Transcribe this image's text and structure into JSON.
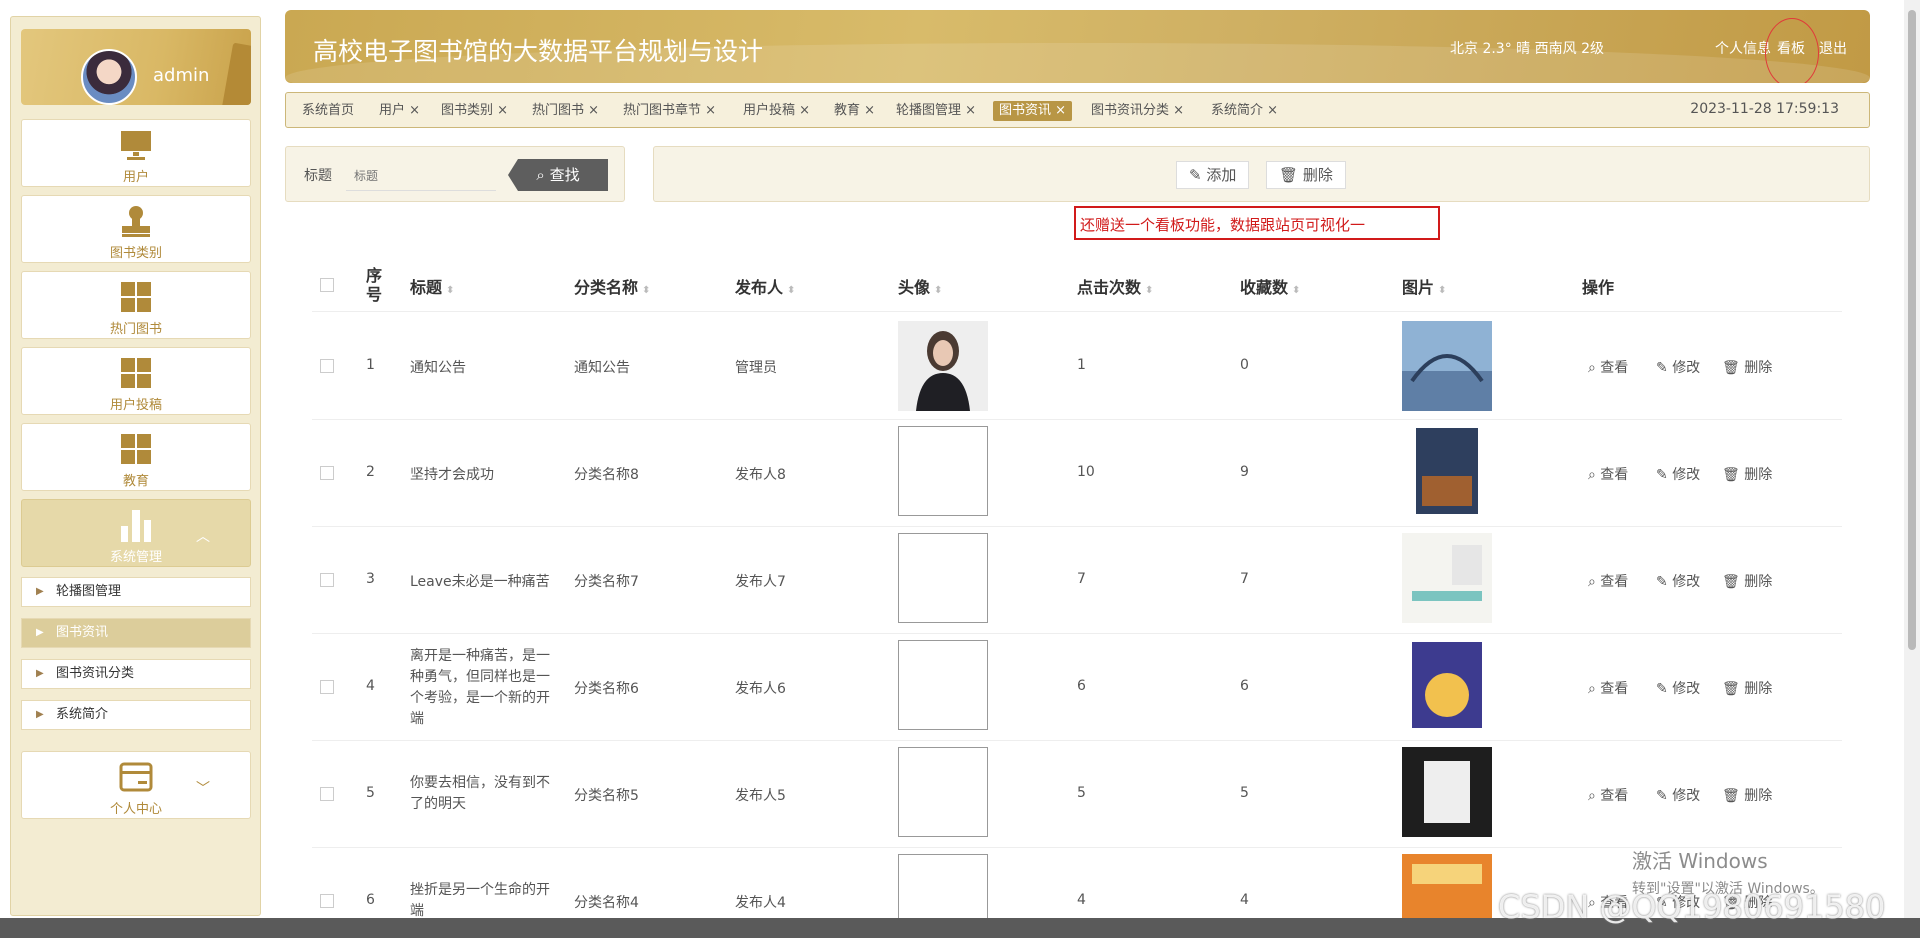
{
  "sidebar": {
    "username": "admin",
    "nav": [
      {
        "label": "用户",
        "icon": "monitor-icon"
      },
      {
        "label": "图书类别",
        "icon": "stamp-icon"
      },
      {
        "label": "热门图书",
        "icon": "grid-icon"
      },
      {
        "label": "用户投稿",
        "icon": "grid-icon"
      },
      {
        "label": "教育",
        "icon": "grid-icon"
      },
      {
        "label": "系统管理",
        "icon": "bar-chart-icon"
      }
    ],
    "sub_items": [
      {
        "label": "轮播图管理"
      },
      {
        "label": "图书资讯"
      },
      {
        "label": "图书资讯分类"
      },
      {
        "label": "系统简介"
      }
    ],
    "personal": {
      "label": "个人中心",
      "icon": "card-icon"
    }
  },
  "header": {
    "title": "高校电子图书馆的大数据平台规划与设计",
    "weather": "北京  2.3°  晴  西南风  2级",
    "links": [
      "个人信息",
      "看板",
      "退出"
    ]
  },
  "tabs": [
    {
      "label": "系统首页"
    },
    {
      "label": "用户 ×"
    },
    {
      "label": "图书类别 ×"
    },
    {
      "label": "热门图书 ×"
    },
    {
      "label": "热门图书章节 ×"
    },
    {
      "label": "用户投稿 ×"
    },
    {
      "label": "教育 ×"
    },
    {
      "label": "轮播图管理 ×"
    },
    {
      "label": "图书资讯 ×"
    },
    {
      "label": "图书资讯分类 ×"
    },
    {
      "label": "系统简介 ×"
    }
  ],
  "datetime": "2023-11-28 17:59:13",
  "search": {
    "label": "标题",
    "placeholder": "标题",
    "button": "查找"
  },
  "actions": {
    "add": "添加",
    "delete": "删除"
  },
  "annotation": "还赠送一个看板功能，数据跟站页可视化一",
  "table": {
    "headers": [
      "序号",
      "标题",
      "分类名称",
      "发布人",
      "头像",
      "点击次数",
      "收藏数",
      "图片",
      "操作"
    ],
    "rows": [
      {
        "no": "1",
        "title": "通知公告",
        "category": "通知公告",
        "publisher": "管理员",
        "clicks": "1",
        "favs": "0"
      },
      {
        "no": "2",
        "title": "坚持才会成功",
        "category": "分类名称8",
        "publisher": "发布人8",
        "clicks": "10",
        "favs": "9"
      },
      {
        "no": "3",
        "title": "Leave未必是一种痛苦",
        "category": "分类名称7",
        "publisher": "发布人7",
        "clicks": "7",
        "favs": "7"
      },
      {
        "no": "4",
        "title": "离开是一种痛苦，是一种勇气，但同样也是一个考验，是一个新的开端",
        "category": "分类名称6",
        "publisher": "发布人6",
        "clicks": "6",
        "favs": "6"
      },
      {
        "no": "5",
        "title": "你要去相信，没有到不了的明天",
        "category": "分类名称5",
        "publisher": "发布人5",
        "clicks": "5",
        "favs": "5"
      },
      {
        "no": "6",
        "title": "挫折是另一个生命的开端",
        "category": "分类名称4",
        "publisher": "发布人4",
        "clicks": "4",
        "favs": "4"
      }
    ],
    "ops": [
      "查看",
      "修改",
      "删除"
    ]
  },
  "watermark": {
    "windows_title": "激活 Windows",
    "windows_sub": "转到\"设置\"以激活 Windows。",
    "csdn": "CSDN @QQ1980691580"
  }
}
